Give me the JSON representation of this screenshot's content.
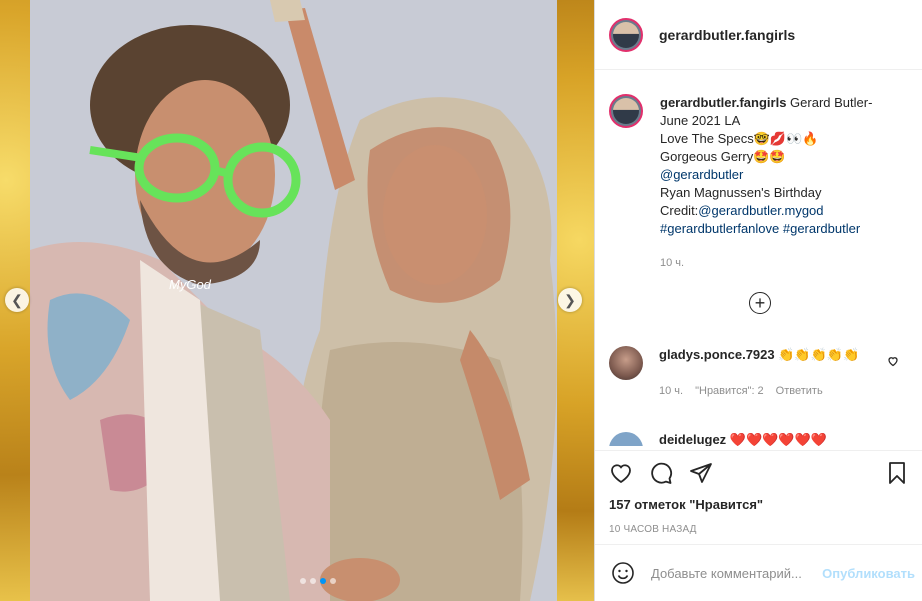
{
  "post": {
    "username": "gerardbutler.fangirls",
    "watermark": "MyGod",
    "caption": {
      "username": "gerardbutler.fangirls",
      "line1": "Gerard Butler-",
      "line2": "June 2021 LA",
      "line3": "Love The Specs🤓💋👀🔥",
      "line4": "Gorgeous Gerry🤩🤩",
      "mention1": "@gerardbutler",
      "line5": "Ryan Magnussen's Birthday",
      "credit_label": "Credit:",
      "credit_link": "@gerardbutler.mygod",
      "tags": "#gerardbutlerfanlove #gerardbutler",
      "time": "10 ч."
    },
    "comments": [
      {
        "username": "gladys.ponce.7923",
        "text": "👏👏👏👏👏",
        "time": "10 ч.",
        "likes": "\"Нравится\": 2",
        "reply": "Ответить"
      },
      {
        "username": "deidelugez",
        "text": "❤️❤️❤️❤️❤️❤️"
      }
    ],
    "likes_text": "157 отметок \"Нравится\"",
    "posted_time": "10 ЧАСОВ НАЗАД",
    "add_comment_placeholder": "Добавьте комментарий...",
    "publish_label": "Опубликовать",
    "carousel": {
      "count": 4,
      "active": 2
    }
  },
  "icons": {
    "prev": "chevron-left-icon",
    "next": "chevron-right-icon",
    "more": "plus-circle-icon",
    "like": "heart-icon",
    "comment": "comment-icon",
    "share": "share-icon",
    "save": "bookmark-icon",
    "emoji": "smiley-icon"
  },
  "colors": {
    "link": "#00376b",
    "active_dot": "#0095f6",
    "publish": "#b2dffc",
    "story_ring": "#e1306c"
  }
}
